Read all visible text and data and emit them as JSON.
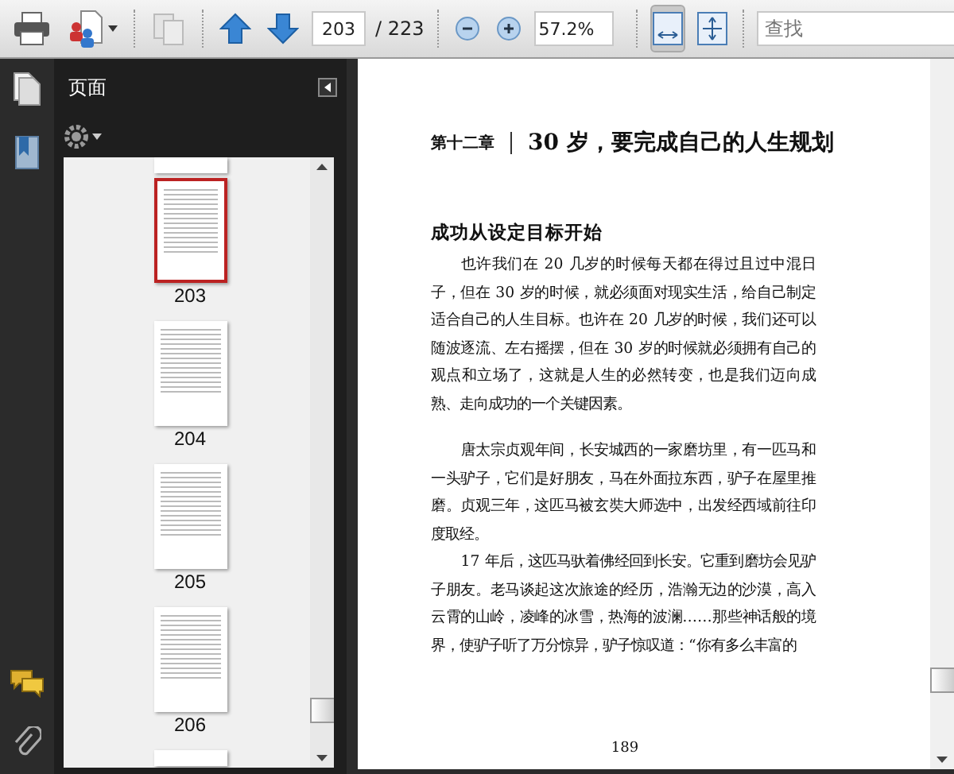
{
  "toolbar": {
    "page_field": {
      "value": "203"
    },
    "page_total": "/ 223",
    "zoom_field": {
      "value": "57.2%"
    },
    "view_buttons": [
      {
        "kind": "fit-width",
        "selected": true
      },
      {
        "kind": "fit-page",
        "selected": false
      }
    ],
    "search": {
      "placeholder": "查找"
    }
  },
  "sidebar": {
    "title": "页面",
    "thumbnails": [
      {
        "label": "203",
        "selected": true
      },
      {
        "label": "204",
        "selected": false
      },
      {
        "label": "205",
        "selected": false
      },
      {
        "label": "206",
        "selected": false
      }
    ]
  },
  "document": {
    "chapter": "第十二章",
    "chapter_title": "30 岁，要完成自己的人生规划",
    "section_heading": "成功从设定目标开始",
    "paragraphs": [
      "也许我们在 20 几岁的时候每天都在得过且过中混日子，但在 30 岁的时候，就必须面对现实生活，给自己制定适合自己的人生目标。也许在 20 几岁的时候，我们还可以随波逐流、左右摇摆，但在 30 岁的时候就必须拥有自己的观点和立场了，这就是人生的必然转变，也是我们迈向成熟、走向成功的一个关键因素。",
      "唐太宗贞观年间，长安城西的一家磨坊里，有一匹马和一头驴子，它们是好朋友，马在外面拉东西，驴子在屋里推磨。贞观三年，这匹马被玄奘大师选中，出发经西域前往印度取经。",
      "17 年后，这匹马驮着佛经回到长安。它重到磨坊会见驴子朋友。老马谈起这次旅途的经历，浩瀚无边的沙漠，高入云霄的山岭，凌峰的冰雪，热海的波澜……那些神话般的境界，使驴子听了万分惊异，驴子惊叹道：“你有多么丰富的"
    ],
    "page_number": "189"
  }
}
